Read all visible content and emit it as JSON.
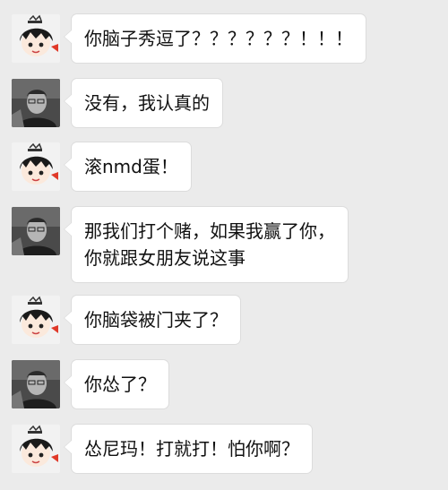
{
  "chat": {
    "messages": [
      {
        "sender": "cartoon",
        "lines": [
          "你脑子秀逗了？？？？？？！！！"
        ]
      },
      {
        "sender": "photo",
        "lines": [
          "没有，我认真的"
        ]
      },
      {
        "sender": "cartoon",
        "lines": [
          "滚nmd蛋！"
        ]
      },
      {
        "sender": "photo",
        "lines": [
          "那我们打个赌，如果我赢了你，",
          "你就跟女朋友说这事"
        ]
      },
      {
        "sender": "cartoon",
        "lines": [
          "你脑袋被门夹了？"
        ]
      },
      {
        "sender": "photo",
        "lines": [
          "你怂了？"
        ]
      },
      {
        "sender": "cartoon",
        "lines": [
          "怂尼玛！打就打！怕你啊？"
        ]
      }
    ]
  },
  "colors": {
    "background": "#ebebeb",
    "bubble": "#ffffff",
    "text": "#111111"
  }
}
